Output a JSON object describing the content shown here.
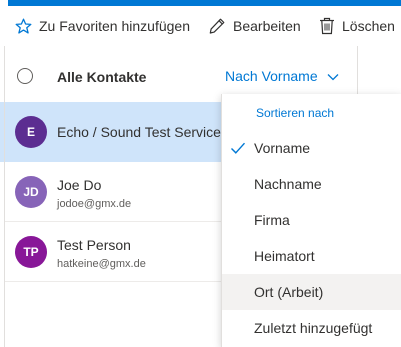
{
  "toolbar": {
    "favorites_label": "Zu Favoriten hinzufügen",
    "edit_label": "Bearbeiten",
    "delete_label": "Löschen"
  },
  "list": {
    "all_contacts_label": "Alle Kontakte",
    "sort_label": "Nach Vorname"
  },
  "contacts": [
    {
      "initials": "E",
      "name": "Echo / Sound Test Service",
      "email": "",
      "color": "#5c2d91",
      "selected": true
    },
    {
      "initials": "JD",
      "name": "Joe Do",
      "email": "jodoe@gmx.de",
      "color": "#8764b8",
      "selected": false
    },
    {
      "initials": "TP",
      "name": "Test Person",
      "email": "hatkeine@gmx.de",
      "color": "#881798",
      "selected": false
    }
  ],
  "sort_menu": {
    "title": "Sortieren nach",
    "items": [
      {
        "label": "Vorname",
        "checked": true
      },
      {
        "label": "Nachname",
        "checked": false
      },
      {
        "label": "Firma",
        "checked": false
      },
      {
        "label": "Heimatort",
        "checked": false
      },
      {
        "label": "Ort (Arbeit)",
        "checked": false,
        "hovered": true
      },
      {
        "label": "Zuletzt hinzugefügt",
        "checked": false
      }
    ]
  },
  "colors": {
    "accent": "#0078d4",
    "selection": "#cfe4fa",
    "hover": "#f3f2f1"
  }
}
